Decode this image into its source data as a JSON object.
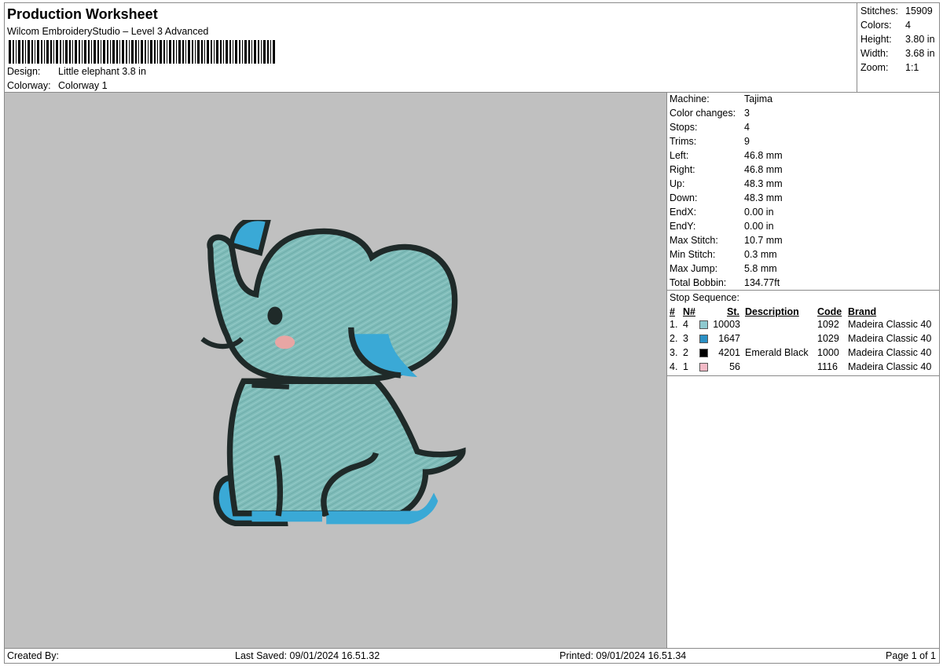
{
  "header": {
    "title": "Production Worksheet",
    "software": "Wilcom EmbroideryStudio – Level 3 Advanced",
    "design_label": "Design:",
    "design_value": "Little elephant 3.8 in",
    "colorway_label": "Colorway:",
    "colorway_value": "Colorway 1"
  },
  "summary": {
    "stitches_label": "Stitches:",
    "stitches_value": "15909",
    "colors_label": "Colors:",
    "colors_value": "4",
    "height_label": "Height:",
    "height_value": "3.80 in",
    "width_label": "Width:",
    "width_value": "3.68 in",
    "zoom_label": "Zoom:",
    "zoom_value": "1:1"
  },
  "details": {
    "stats": [
      {
        "label": "Machine:",
        "value": "Tajima"
      },
      {
        "label": "Color changes:",
        "value": "3"
      },
      {
        "label": "Stops:",
        "value": "4"
      },
      {
        "label": "Trims:",
        "value": "9"
      },
      {
        "label": "Left:",
        "value": "46.8 mm"
      },
      {
        "label": "Right:",
        "value": "46.8 mm"
      },
      {
        "label": "Up:",
        "value": "48.3 mm"
      },
      {
        "label": "Down:",
        "value": "48.3 mm"
      },
      {
        "label": "EndX:",
        "value": "0.00 in"
      },
      {
        "label": "EndY:",
        "value": "0.00 in"
      },
      {
        "label": "Max Stitch:",
        "value": "10.7 mm"
      },
      {
        "label": "Min Stitch:",
        "value": "0.3 mm"
      },
      {
        "label": "Max Jump:",
        "value": "5.8 mm"
      },
      {
        "label": "Total Bobbin:",
        "value": "134.77ft"
      }
    ],
    "stop_sequence_title": "Stop Sequence:",
    "columns": {
      "num": "#",
      "needle": "N#",
      "stitches": "St.",
      "description": "Description",
      "code": "Code",
      "brand": "Brand"
    },
    "sequence": [
      {
        "num": "1.",
        "needle": "4",
        "color": "#8ec9cf",
        "stitches": "10003",
        "description": "",
        "code": "1092",
        "brand": "Madeira Classic 40"
      },
      {
        "num": "2.",
        "needle": "3",
        "color": "#2a8fc4",
        "stitches": "1647",
        "description": "",
        "code": "1029",
        "brand": "Madeira Classic 40"
      },
      {
        "num": "3.",
        "needle": "2",
        "color": "#000000",
        "stitches": "4201",
        "description": "Emerald Black",
        "code": "1000",
        "brand": "Madeira Classic 40"
      },
      {
        "num": "4.",
        "needle": "1",
        "color": "#f2b9c6",
        "stitches": "56",
        "description": "",
        "code": "1116",
        "brand": "Madeira Classic 40"
      }
    ]
  },
  "footer": {
    "created_by": "Created By:",
    "last_saved": "Last Saved: 09/01/2024 16.51.32",
    "printed": "Printed: 09/01/2024 16.51.34",
    "page": "Page 1 of 1"
  },
  "colors": {
    "preview_bg": "#c0c0c0",
    "body_fill": "#7fbcb9",
    "shadow_fill": "#3aa9d6",
    "outline": "#1f2a29",
    "cheek": "#e8a6a4"
  }
}
